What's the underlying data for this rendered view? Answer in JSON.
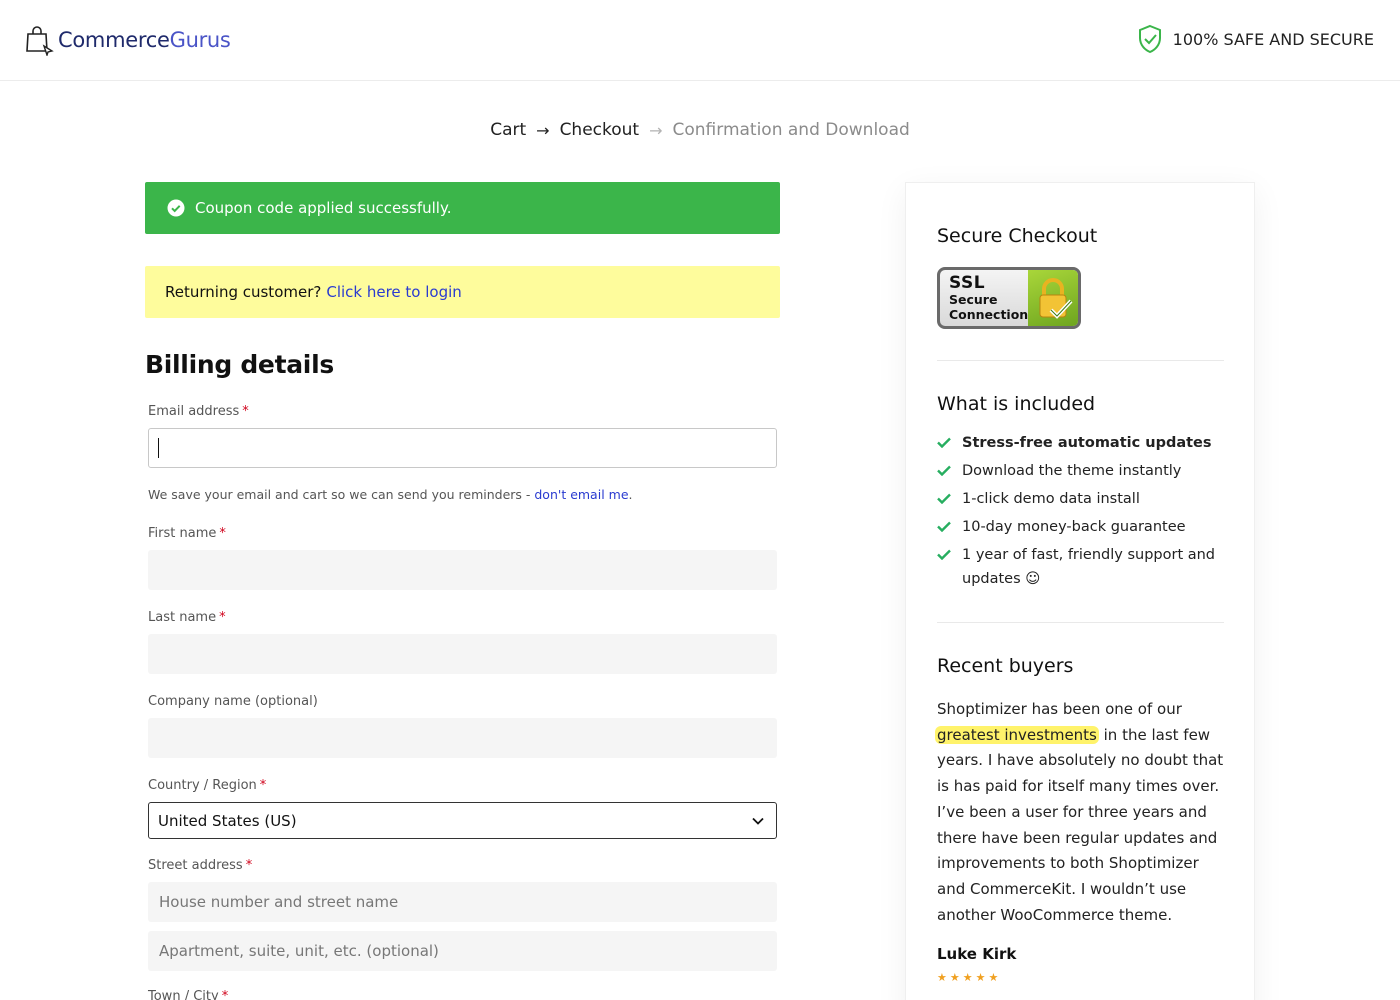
{
  "header": {
    "logo_commerce": "Commerce",
    "logo_gurus": "Gurus",
    "safe_text": "100% SAFE AND SECURE"
  },
  "breadcrumb": {
    "steps": [
      "Cart",
      "Checkout",
      "Confirmation and Download"
    ],
    "arrow": "→"
  },
  "notices": {
    "success": "Coupon code applied successfully.",
    "login_prompt": "Returning customer?",
    "login_link": "Click here to login"
  },
  "billing": {
    "title": "Billing details",
    "required_mark": "*",
    "email_label": "Email address",
    "email_value": "",
    "email_helper": "We save your email and cart so we can send you reminders - ",
    "email_helper_link": "don't email me",
    "email_helper_end": ".",
    "first_name_label": "First name",
    "last_name_label": "Last name",
    "company_label": "Company name (optional)",
    "country_label": "Country / Region",
    "country_value": "United States (US)",
    "street_label": "Street address",
    "street_placeholder": "House number and street name",
    "street2_placeholder": "Apartment, suite, unit, etc. (optional)",
    "town_label": "Town / City"
  },
  "sidebar": {
    "secure_title": "Secure Checkout",
    "ssl_big": "SSL",
    "ssl_line1": "Secure",
    "ssl_line2": "Connection",
    "included_title": "What is included",
    "included": [
      "Stress-free automatic updates",
      "Download the theme instantly",
      "1-click demo data install",
      "10-day money-back guarantee",
      "1 year of fast, friendly support and updates ☺"
    ],
    "buyers_title": "Recent buyers",
    "review_before": "Shoptimizer has been one of our ",
    "review_highlight": "greatest investments",
    "review_after": " in the last few years. I have absolutely no doubt that is has paid for itself many times over. I’ve been a user for three years and there have been regular updates and improvements to both Shoptimizer and CommerceKit. I wouldn’t use another WooCommerce theme.",
    "reviewer": "Luke Kirk",
    "stars": "★★★★★"
  },
  "colors": {
    "success": "#3bb54a",
    "login_bg": "#fefc9c",
    "link": "#2a3bd0",
    "check": "#27ae60",
    "highlight": "#fff36b"
  }
}
